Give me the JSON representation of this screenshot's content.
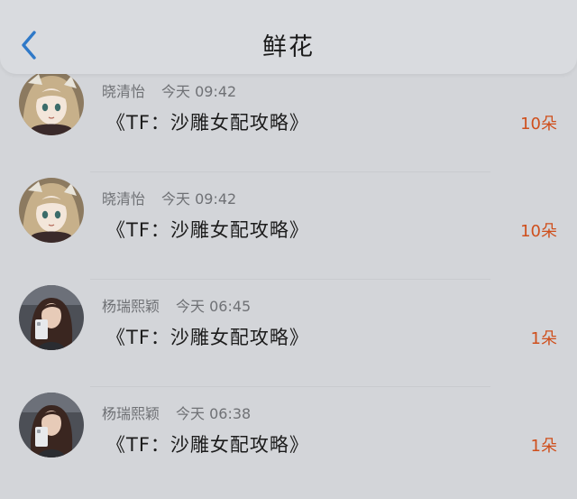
{
  "header": {
    "title": "鲜花",
    "back_icon": "chevron-left-icon"
  },
  "colors": {
    "background": "#d3d5d9",
    "header_bg": "#d9dbdf",
    "accent_back": "#2f79c8",
    "amount": "#cf4f1c",
    "meta_text": "#6f7175",
    "title_text": "#1a1a1a"
  },
  "records": [
    {
      "user": "晓清怡",
      "time": "今天 09:42",
      "book": "《TF：沙雕女配攻略》",
      "amount": "10朵",
      "avatar": "anime-girl-avatar"
    },
    {
      "user": "晓清怡",
      "time": "今天 09:42",
      "book": "《TF：沙雕女配攻略》",
      "amount": "10朵",
      "avatar": "anime-girl-avatar"
    },
    {
      "user": "杨瑞熙颖",
      "time": "今天 06:45",
      "book": "《TF：沙雕女配攻略》",
      "amount": "1朵",
      "avatar": "selfie-photo-avatar"
    },
    {
      "user": "杨瑞熙颖",
      "time": "今天 06:38",
      "book": "《TF：沙雕女配攻略》",
      "amount": "1朵",
      "avatar": "selfie-photo-avatar"
    }
  ]
}
